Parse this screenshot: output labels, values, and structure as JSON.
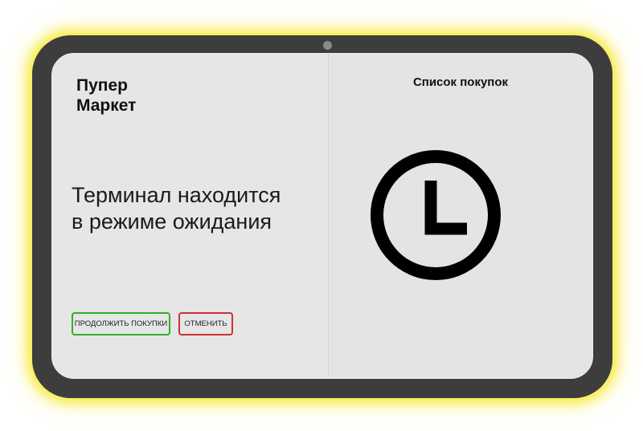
{
  "brand": {
    "name_line1": "Пупер",
    "name_line2": "Маркет"
  },
  "status": {
    "message_line1": "Терминал находится",
    "message_line2": "в режиме ожидания"
  },
  "actions": {
    "continue_label": "ПРОДОЛЖИТЬ ПОКУПКИ",
    "cancel_label": "ОТМЕНИТЬ"
  },
  "shopping_list": {
    "title": "Список покупок",
    "status_icon": "clock-icon"
  },
  "colors": {
    "device_frame": "#3d3d3d",
    "device_glow": "#f6e828",
    "screen_background": "#e5e5e5",
    "continue_border": "#2db02d",
    "cancel_border": "#d13030",
    "clock": "#000000"
  }
}
